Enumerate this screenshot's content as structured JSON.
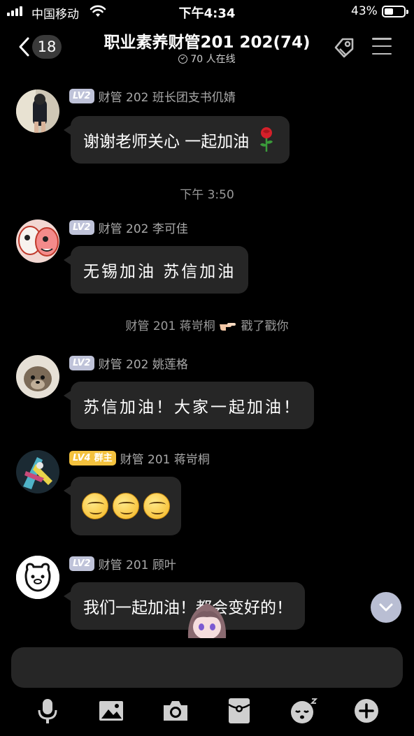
{
  "status_bar": {
    "carrier": "中国移动",
    "time": "下午4:34",
    "battery": "43%"
  },
  "header": {
    "back_count": "18",
    "title": "职业素养财管201 202(74)",
    "online": "70 人在线"
  },
  "messages": [
    {
      "level": "LV2",
      "sender": "财管 202 班长团支书仉婧",
      "text": "谢谢老师关心 一起加油",
      "emoji": "rose-emoji"
    },
    {
      "level": "LV2",
      "sender": "财管 202 李可佳",
      "text": "无锡加油 苏信加油"
    },
    {
      "level": "LV2",
      "sender": "财管 202 姚莲格",
      "text": "苏信加油！大家一起加油！"
    },
    {
      "level": "LV4",
      "role": "群主",
      "sender": "财管 201 蒋岢桐",
      "emoji": "smirk-emoji",
      "emoji_count": 3
    },
    {
      "level": "LV2",
      "sender": "财管 201 顾叶",
      "text": "我们一起加油！都会变好的！"
    }
  ],
  "time_divider": "下午 3:50",
  "poke_notice": {
    "actor": "财管 201 蒋岢桐",
    "action": "戳了戳你"
  },
  "colors": {
    "background": "#000000",
    "bubble": "#262626",
    "level_badge": "#bfc3d9",
    "owner_badge": "#f4c23e"
  }
}
